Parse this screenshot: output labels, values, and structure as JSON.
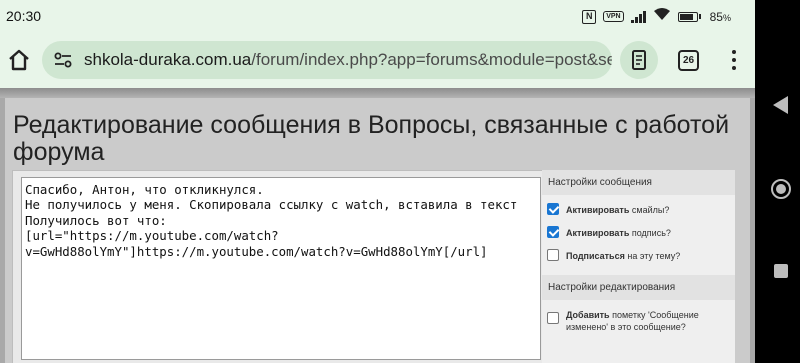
{
  "statusbar": {
    "time": "20:30",
    "battery": "85",
    "battery_unit": "%",
    "vpn_label": "VPN",
    "nfc_label": "N"
  },
  "browser": {
    "url_host": "shkola-duraka.com.ua",
    "url_path": "/forum/index.php?app=forums&module=post&sectio",
    "tab_count": "26",
    "icons": [
      "home-icon",
      "site-settings-icon",
      "reader-mode-icon",
      "tabs-icon",
      "overflow-menu-icon"
    ]
  },
  "page": {
    "title": "Редактирование сообщения в Вопросы, связанные с работой форума",
    "message": "Спасибо, Антон, что откликнулся.\nНе получилось у меня. Скопировала ссылку с watch, вставила в текст\nПолучилось вот что:\n[url=\"https://m.youtube.com/watch?\nv=GwHd88olYmY\"]https://m.youtube.com/watch?v=GwHd88olYmY[/url]"
  },
  "sidebar": {
    "message_settings_title": "Настройки сообщения",
    "options": [
      {
        "bold": "Активировать",
        "rest": " смайлы?",
        "checked": true
      },
      {
        "bold": "Активировать",
        "rest": " подпись?",
        "checked": true
      },
      {
        "bold": "Подписаться",
        "rest": " на эту тему?",
        "checked": false
      }
    ],
    "edit_settings_title": "Настройки редактирования",
    "edit_option": {
      "bold": "Добавить",
      "rest": " пометку 'Сообщение изменено' в это сообщение?",
      "checked": false
    }
  },
  "colors": {
    "browser_bg": "#e8f5e9",
    "urlbar_bg": "#cfe6d1",
    "checkbox_on": "#1976d2"
  }
}
